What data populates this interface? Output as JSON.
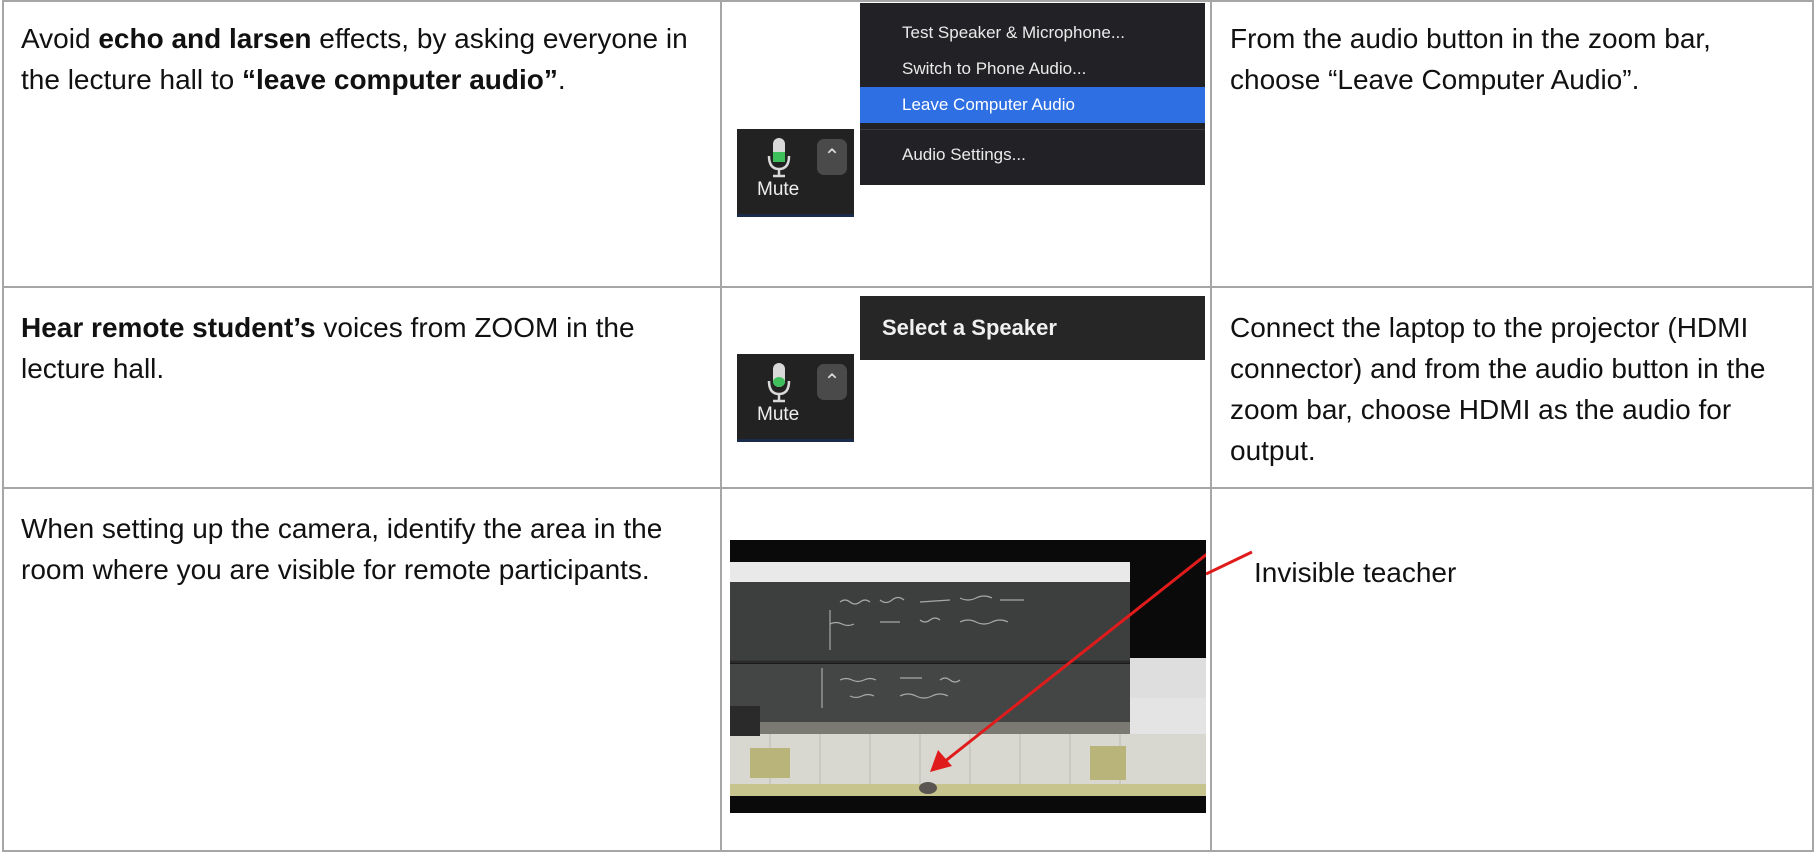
{
  "rows": [
    {
      "left_parts": [
        {
          "text": "Avoid ",
          "bold": false
        },
        {
          "text": "echo and larsen",
          "bold": true
        },
        {
          "text": " effects, by asking everyone in the lecture hall to ",
          "bold": false
        },
        {
          "text": "“leave computer audio”",
          "bold": true
        },
        {
          "text": ".",
          "bold": false
        }
      ],
      "right_text": "From the audio button in the zoom bar, choose “Leave Computer Audio”."
    },
    {
      "left_parts": [
        {
          "text": "Hear remote student’s",
          "bold": true
        },
        {
          "text": " voices from ZOOM in the lecture hall.",
          "bold": false
        }
      ],
      "right_text": "Connect the laptop to the projector (HDMI connector) and from the audio button in the zoom bar, choose HDMI as the audio for output."
    },
    {
      "left_parts": [
        {
          "text": "When setting up the camera, identify the area in the room where you are visible for remote participants.",
          "bold": false
        }
      ],
      "right_text": ""
    }
  ],
  "zoom_bar": {
    "mute_label": "Mute",
    "chevron_icon": "chevron-up-icon",
    "mic_icon": "microphone-icon",
    "mic_level_color": "#3fbf5b"
  },
  "audio_menu": {
    "items": [
      {
        "label": "Test Speaker & Microphone...",
        "selected": false
      },
      {
        "label": "Switch to Phone Audio...",
        "selected": false
      },
      {
        "label": "Leave Computer Audio",
        "selected": true
      },
      {
        "label": "Audio Settings...",
        "selected": false
      }
    ],
    "highlight_color": "#2e6fe4"
  },
  "speaker_popup": {
    "title": "Select a Speaker"
  },
  "photo": {
    "caption": "Invisible teacher",
    "arrow_color": "#e01b1b"
  }
}
